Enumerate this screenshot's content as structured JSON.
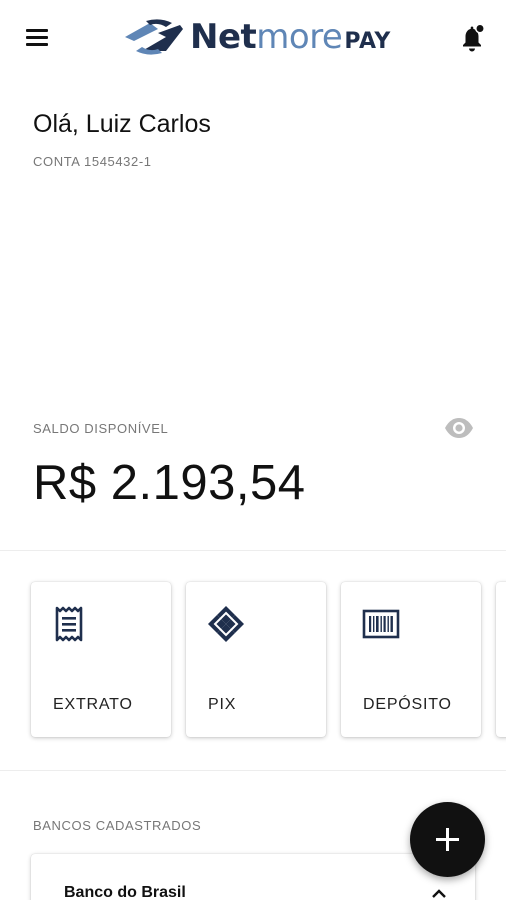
{
  "header": {
    "logo": {
      "net": "Net",
      "more": "more",
      "pay": "PAY"
    },
    "menu_icon": "hamburger-menu-icon",
    "notification_icon": "bell-icon"
  },
  "profile": {
    "greeting": "Olá, Luiz Carlos",
    "account": "CONTA 1545432-1"
  },
  "balance": {
    "label": "SALDO DISPONÍVEL",
    "value": "R$ 2.193,54",
    "visibility_icon": "eye-icon"
  },
  "actions": [
    {
      "label": "EXTRATO",
      "icon": "receipt-icon"
    },
    {
      "label": "PIX",
      "icon": "pix-icon"
    },
    {
      "label": "DEPÓSITO",
      "icon": "barcode-icon"
    }
  ],
  "banks": {
    "label": "BANCOS CADASTRADOS",
    "items": [
      {
        "name": "Banco do Brasil",
        "icon": "chevron-up-icon"
      }
    ]
  },
  "fab": {
    "icon": "plus-icon"
  },
  "colors": {
    "brand_dark": "#1f2f4d",
    "brand_light": "#5f86b6",
    "text_primary": "#111111",
    "text_secondary": "#777777"
  }
}
